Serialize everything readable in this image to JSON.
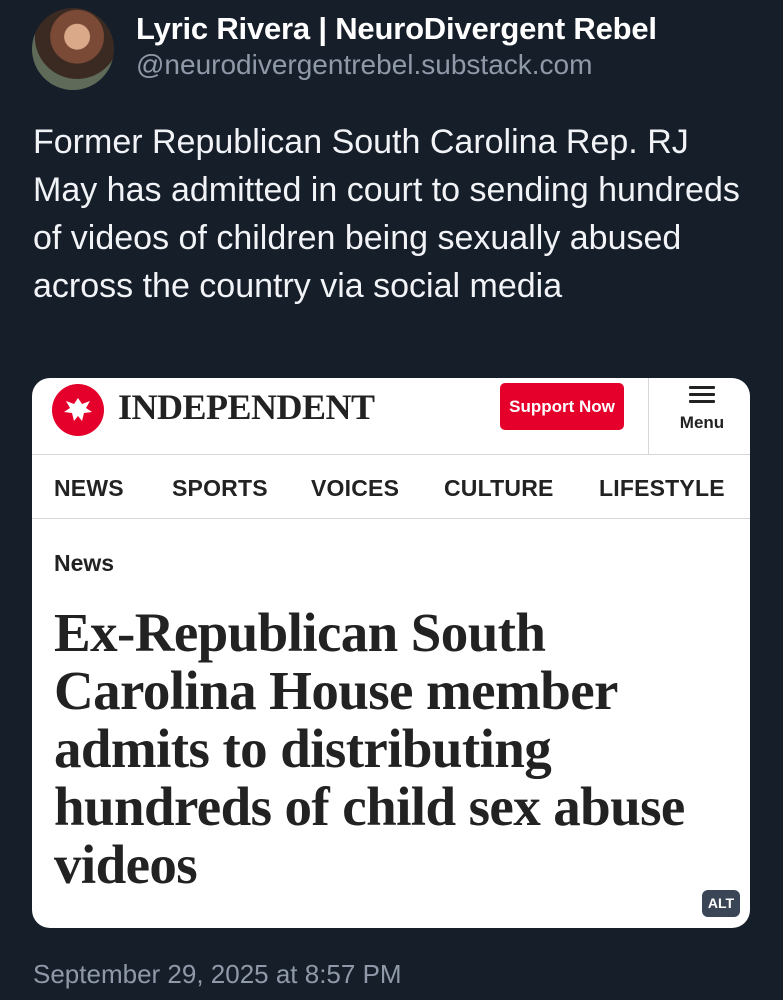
{
  "post": {
    "author": {
      "display_name": "Lyric Rivera | NeuroDivergent Rebel",
      "handle": "@neurodivergentrebel.substack.com"
    },
    "text": "Former Republican South Carolina Rep. RJ May has admitted in court to sending hundreds of videos of children being sexually abused across the country via social media",
    "timestamp": "September 29, 2025 at 8:57 PM"
  },
  "embed": {
    "publication": "INDEPENDENT",
    "support_label": "Support Now",
    "menu_label": "Menu",
    "nav": [
      "NEWS",
      "SPORTS",
      "VOICES",
      "CULTURE",
      "LIFESTYLE"
    ],
    "section": "News",
    "headline": "Ex-Republican South Carolina House member admits to distributing hundreds of child sex abuse videos",
    "alt_badge": "ALT"
  },
  "colors": {
    "background": "#161e2a",
    "brand_red": "#e4002b",
    "muted_text": "#8f99a8"
  },
  "icons": {
    "logo": "eagle-logo-icon",
    "menu": "hamburger-menu-icon"
  }
}
